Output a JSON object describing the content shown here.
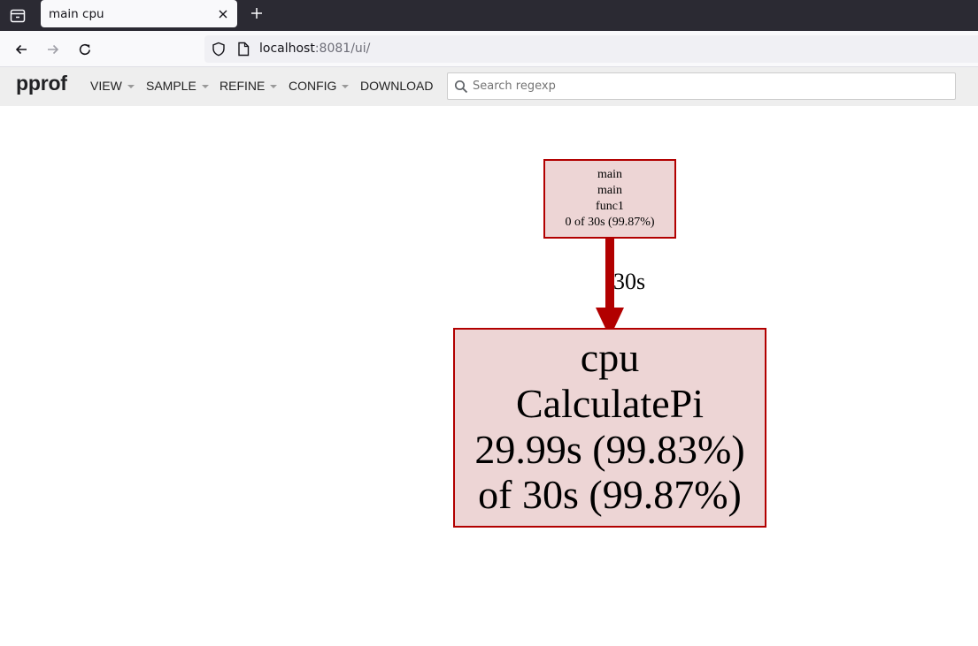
{
  "browser": {
    "tab_title": "main cpu",
    "url_host": "localhost",
    "url_rest": ":8081/ui/",
    "icons": {
      "tab_list": "tab-list-icon",
      "close": "close-icon",
      "new_tab": "plus-icon",
      "back": "back-arrow-icon",
      "forward": "forward-arrow-icon",
      "reload": "reload-icon",
      "security": "shield-icon",
      "page": "page-icon"
    }
  },
  "app": {
    "logo": "pprof",
    "menus": {
      "view": "VIEW",
      "sample": "SAMPLE",
      "refine": "REFINE",
      "config": "CONFIG",
      "download": "DOWNLOAD"
    },
    "search": {
      "placeholder": "Search regexp",
      "value": ""
    }
  },
  "graph": {
    "colors": {
      "node_fill": "#edd5d5",
      "node_stroke": "#b20000",
      "edge": "#b20000"
    },
    "nodes": {
      "caller": {
        "line1": "main",
        "line2": "main",
        "line3": "func1",
        "line4": "0 of 30s (99.87%)"
      },
      "callee": {
        "line1": "cpu",
        "line2": "CalculatePi",
        "line3": "29.99s (99.83%)",
        "line4": "of 30s (99.87%)"
      }
    },
    "edge": {
      "label": "30s"
    }
  }
}
